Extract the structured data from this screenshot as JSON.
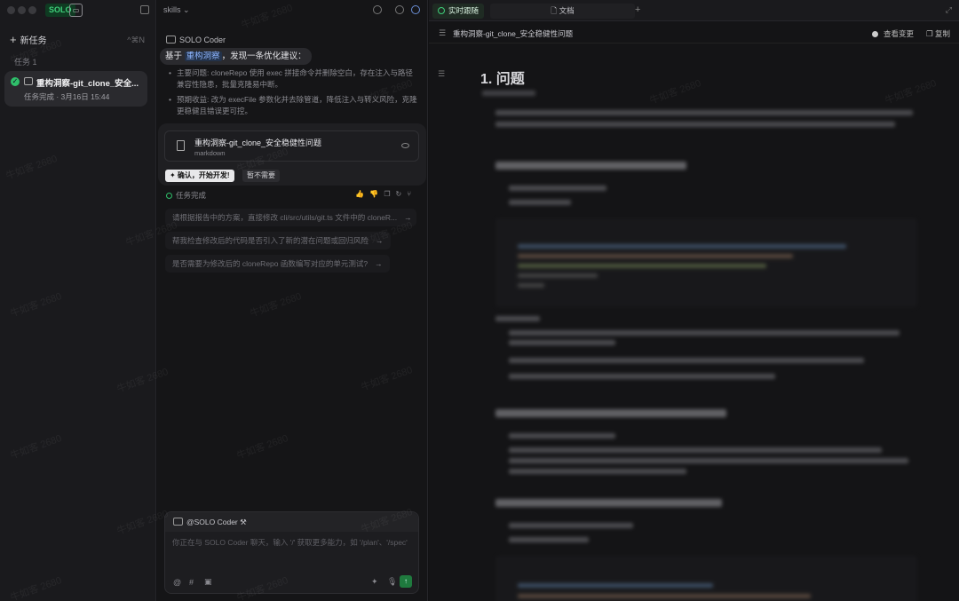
{
  "sidebar": {
    "logo_label": "SOLO",
    "new_task_label": "新任务",
    "new_task_shortcut": "^⌘N",
    "tasks_section_label": "任务 1",
    "task": {
      "title": "重构洞察-git_clone_安全...",
      "status": "任务完成 · 3月16日 15:44"
    }
  },
  "chat": {
    "skills_label": "skills",
    "agent_name": "SOLO Coder",
    "bubble_prefix": "基于",
    "bubble_highlight": "重构洞察",
    "bubble_suffix": "，发现一条优化建议：",
    "bullets": [
      "主要问题: cloneRepo 使用 exec 拼接命令并删除空白，存在注入与路径兼容性隐患，批量克隆易中断。",
      "预期收益: 改为 execFile 参数化并去除管道，降低注入与转义风险，克隆更稳健且错误更可控。"
    ],
    "doc_card": {
      "title": "重构洞察-git_clone_安全稳健性问题",
      "type": "markdown"
    },
    "confirm_label": "✦ 确认，开始开发!",
    "decline_label": "暂不需要",
    "done_label": "任务完成",
    "suggestions": [
      "请根据报告中的方案，直接修改 cli/src/utils/git.ts 文件中的 cloneR...",
      "帮我检查修改后的代码是否引入了新的潜在问题或回归风险",
      "是否需要为修改后的 cloneRepo 函数编写对应的单元测试?"
    ],
    "input_header": "@SOLO Coder",
    "input_placeholder": "你正在与 SOLO Coder 聊天，输入 '/' 获取更多能力，如 '/plan'、'/spec'"
  },
  "doc": {
    "live_tab": "实时跟随",
    "doc_tab": "文档",
    "doc_name": "重构洞察-git_clone_安全稳健性问题",
    "changes_label": "查看变更",
    "copy_label": "复制",
    "heading": "1. 问题"
  },
  "watermark": "牛如客 2680"
}
